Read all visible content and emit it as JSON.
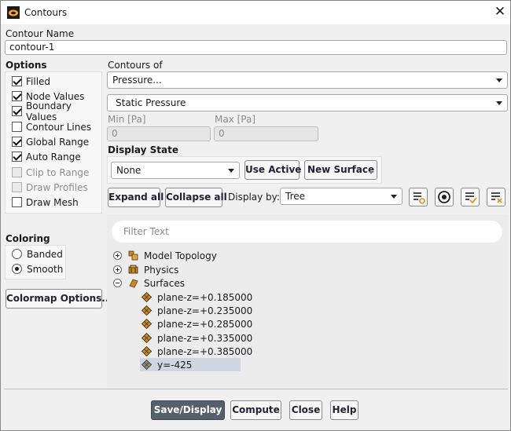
{
  "window": {
    "title": "Contours",
    "close_symbol": "✕"
  },
  "contour_name": {
    "label": "Contour Name",
    "value": "contour-1"
  },
  "options": {
    "heading": "Options",
    "items": [
      {
        "label": "Filled",
        "checked": true,
        "enabled": true
      },
      {
        "label": "Node Values",
        "checked": true,
        "enabled": true
      },
      {
        "label": "Boundary Values",
        "checked": true,
        "enabled": true
      },
      {
        "label": "Contour Lines",
        "checked": false,
        "enabled": true
      },
      {
        "label": "Global Range",
        "checked": true,
        "enabled": true
      },
      {
        "label": "Auto Range",
        "checked": true,
        "enabled": true
      },
      {
        "label": "Clip to Range",
        "checked": false,
        "enabled": false
      },
      {
        "label": "Draw Profiles",
        "checked": false,
        "enabled": false
      },
      {
        "label": "Draw Mesh",
        "checked": false,
        "enabled": true
      }
    ]
  },
  "contours_of": {
    "label": "Contours of",
    "category": "Pressure...",
    "variable": "Static Pressure"
  },
  "range": {
    "min_label": "Min [Pa]",
    "min_value": "0",
    "max_label": "Max [Pa]",
    "max_value": "0"
  },
  "display_state": {
    "label": "Display State",
    "value": "None",
    "use_active": "Use Active",
    "new_surface": "New Surface"
  },
  "tree_toolbar": {
    "expand_all": "Expand all",
    "collapse_all": "Collapse all",
    "display_by_label": "Display by:",
    "display_by_value": "Tree"
  },
  "coloring": {
    "heading": "Coloring",
    "options": [
      {
        "label": "Banded",
        "selected": false
      },
      {
        "label": "Smooth",
        "selected": true
      }
    ]
  },
  "colormap_button": "Colormap Options...",
  "filter_placeholder": "Filter Text",
  "tree": {
    "groups": [
      {
        "label": "Model Topology",
        "expanded": false,
        "icon": "model-topology-icon"
      },
      {
        "label": "Physics",
        "expanded": false,
        "icon": "physics-icon"
      },
      {
        "label": "Surfaces",
        "expanded": true,
        "icon": "surfaces-folder-icon"
      }
    ],
    "surfaces": [
      {
        "label": "plane-z=+0.185000",
        "selected": false
      },
      {
        "label": "plane-z=+0.235000",
        "selected": false
      },
      {
        "label": "plane-z=+0.285000",
        "selected": false
      },
      {
        "label": "plane-z=+0.335000",
        "selected": false
      },
      {
        "label": "plane-z=+0.385000",
        "selected": false
      },
      {
        "label": "y=-425",
        "selected": true
      }
    ]
  },
  "footer": {
    "save_display": "Save/Display",
    "compute": "Compute",
    "close": "Close",
    "help": "Help"
  },
  "colors": {
    "primary_button": "#55606c",
    "selection": "#cfd6e2",
    "surface_icon": "#c8892a"
  }
}
